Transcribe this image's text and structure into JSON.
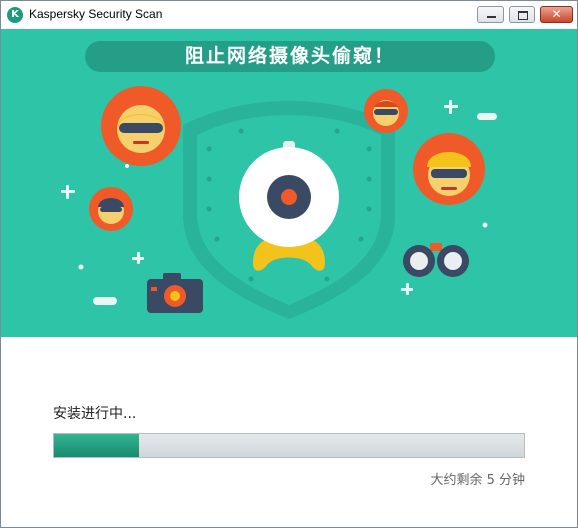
{
  "window": {
    "title": "Kaspersky Security Scan",
    "icon": "kaspersky-logo-icon"
  },
  "banner": {
    "slogan": "阻止网络摄像头偷窥！",
    "background_color": "#2dc4a8",
    "accent_color": "#f05a28"
  },
  "install": {
    "status": "安装进行中...",
    "progress": 0.18,
    "eta": "大约剩余  5 分钟"
  }
}
